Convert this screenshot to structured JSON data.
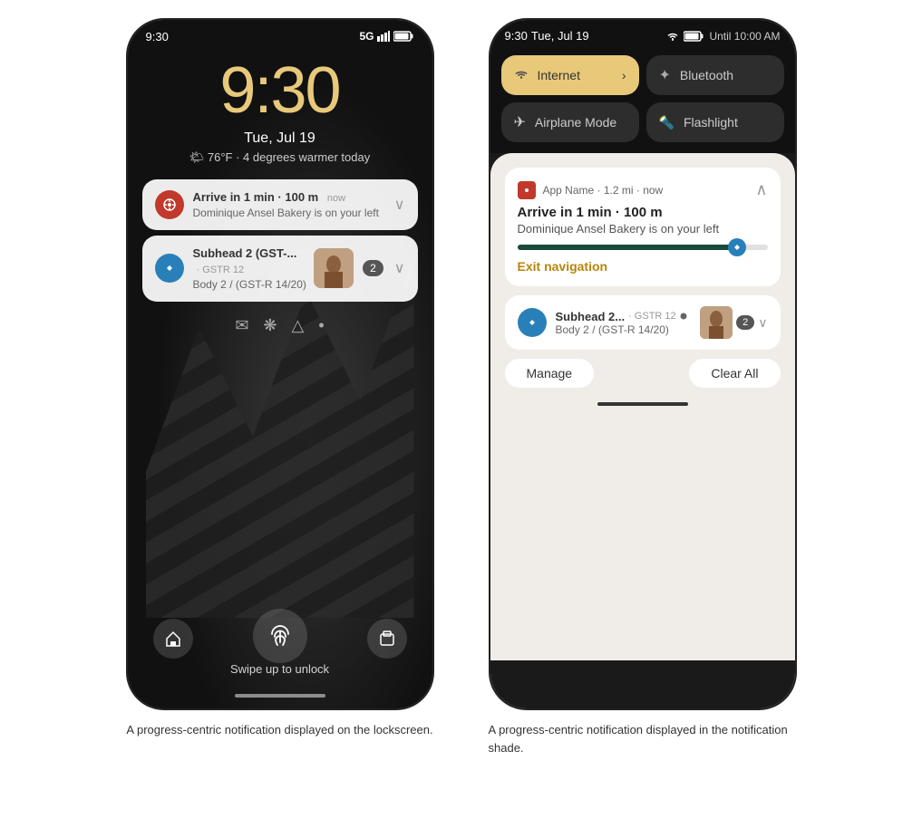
{
  "left_phone": {
    "status_bar": {
      "time": "9:30",
      "signal": "5G",
      "battery": "▮"
    },
    "clock": "9:30",
    "date": "Tue, Jul 19",
    "weather": "🌤 76°F · 4 degrees warmer today",
    "notifications": [
      {
        "id": "nav",
        "icon": "◎",
        "icon_bg": "#c0392b",
        "title": "Arrive in 1 min · 100 m",
        "subtitle": "Dominique Ansel Bakery is on your left",
        "time": "now",
        "has_chevron": true
      },
      {
        "id": "app",
        "icon": "⊕",
        "icon_bg": "#2980b9",
        "title": "Subhead 2 (GST-...",
        "title2": "· GSTR 12",
        "subtitle": "Body 2 / (GST-R 14/20)",
        "has_thumb": true,
        "count": "2"
      }
    ],
    "bottom": {
      "swipe_text": "Swipe up to unlock",
      "bottom_icons": [
        "⊞",
        "⊕",
        "△",
        "•"
      ]
    },
    "caption": "A progress-centric notification displayed on the lockscreen."
  },
  "right_phone": {
    "status_bar": {
      "time": "9:30",
      "date": "Tue, Jul 19",
      "signal": "▼",
      "battery": "🔋",
      "until": "Until 10:00 AM"
    },
    "quick_tiles": [
      {
        "id": "internet",
        "label": "Internet",
        "icon": "▼",
        "active": true,
        "has_chevron": true
      },
      {
        "id": "bluetooth",
        "label": "Bluetooth",
        "icon": "✦",
        "active": false
      },
      {
        "id": "airplane",
        "label": "Airplane Mode",
        "icon": "✈",
        "active": false
      },
      {
        "id": "flashlight",
        "label": "Flashlight",
        "icon": "🔦",
        "active": false
      }
    ],
    "notifications": {
      "expanded": {
        "app_name": "App Name · 1.2 mi · now",
        "title": "Arrive in 1 min · 100 m",
        "body": "Dominique Ansel Bakery is on your left",
        "progress": 88,
        "exit_btn": "Exit navigation"
      },
      "collapsed": {
        "icon_bg": "#2980b9",
        "title": "Subhead 2...",
        "meta": "· GSTR 12",
        "subtitle": "Body 2 / (GST-R 14/20)",
        "count": "2"
      }
    },
    "actions": {
      "manage": "Manage",
      "clear_all": "Clear All"
    },
    "caption": "A progress-centric notification displayed in the notification shade."
  }
}
